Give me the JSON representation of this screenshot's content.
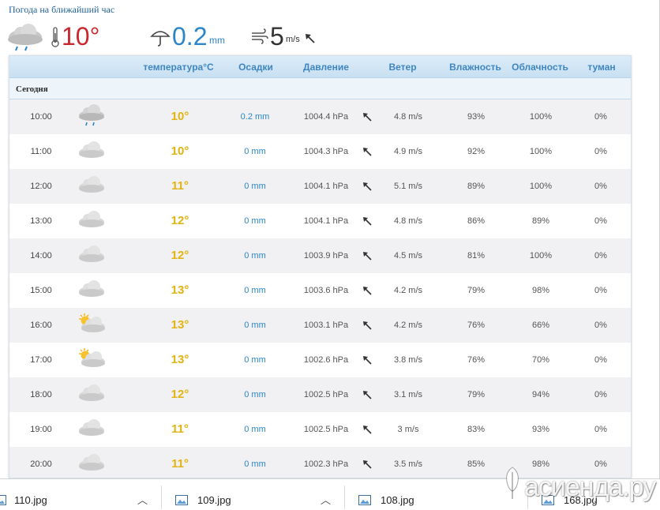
{
  "header": {
    "title": "Погода на ближайший час"
  },
  "now": {
    "temperature": "10°",
    "precipitation": "0.2",
    "precipitation_unit": "mm",
    "wind_speed": "5",
    "wind_unit": "m/s",
    "icons": [
      "rain-cloud-icon",
      "thermometer-icon",
      "umbrella-icon",
      "wind-icon",
      "wind-direction-arrow-icon"
    ]
  },
  "table": {
    "columns": [
      "температура°C",
      "Осадки",
      "Давление",
      "Ветер",
      "Влажность",
      "Облачность",
      "туман"
    ],
    "day_label": "Сегодня",
    "rows": [
      {
        "time": "10:00",
        "icon": "rain-cloud-icon",
        "temp": "10°",
        "precip": "0.2 mm",
        "pressure": "1004.4 hPa",
        "wind": "4.8 m/s",
        "humidity": "93%",
        "cloudiness": "100%",
        "fog": "0%"
      },
      {
        "time": "11:00",
        "icon": "cloud-icon",
        "temp": "10°",
        "precip": "0 mm",
        "pressure": "1004.3 hPa",
        "wind": "4.9 m/s",
        "humidity": "92%",
        "cloudiness": "100%",
        "fog": "0%"
      },
      {
        "time": "12:00",
        "icon": "cloud-icon",
        "temp": "11°",
        "precip": "0 mm",
        "pressure": "1004.1 hPa",
        "wind": "5.1 m/s",
        "humidity": "89%",
        "cloudiness": "100%",
        "fog": "0%"
      },
      {
        "time": "13:00",
        "icon": "cloud-icon",
        "temp": "12°",
        "precip": "0 mm",
        "pressure": "1004.1 hPa",
        "wind": "4.8 m/s",
        "humidity": "86%",
        "cloudiness": "89%",
        "fog": "0%"
      },
      {
        "time": "14:00",
        "icon": "cloud-icon",
        "temp": "12°",
        "precip": "0 mm",
        "pressure": "1003.9 hPa",
        "wind": "4.5 m/s",
        "humidity": "81%",
        "cloudiness": "100%",
        "fog": "0%"
      },
      {
        "time": "15:00",
        "icon": "cloud-icon",
        "temp": "13°",
        "precip": "0 mm",
        "pressure": "1003.6 hPa",
        "wind": "4.2 m/s",
        "humidity": "79%",
        "cloudiness": "98%",
        "fog": "0%"
      },
      {
        "time": "16:00",
        "icon": "sun-cloud-icon",
        "temp": "13°",
        "precip": "0 mm",
        "pressure": "1003.1 hPa",
        "wind": "4.2 m/s",
        "humidity": "76%",
        "cloudiness": "66%",
        "fog": "0%"
      },
      {
        "time": "17:00",
        "icon": "sun-cloud-icon",
        "temp": "13°",
        "precip": "0 mm",
        "pressure": "1002.6 hPa",
        "wind": "3.8 m/s",
        "humidity": "76%",
        "cloudiness": "70%",
        "fog": "0%"
      },
      {
        "time": "18:00",
        "icon": "cloud-icon",
        "temp": "12°",
        "precip": "0 mm",
        "pressure": "1002.5 hPa",
        "wind": "3.1 m/s",
        "humidity": "79%",
        "cloudiness": "94%",
        "fog": "0%"
      },
      {
        "time": "19:00",
        "icon": "cloud-icon",
        "temp": "11°",
        "precip": "0 mm",
        "pressure": "1002.5 hPa",
        "wind": "3 m/s",
        "humidity": "83%",
        "cloudiness": "93%",
        "fog": "0%"
      },
      {
        "time": "20:00",
        "icon": "cloud-icon",
        "temp": "11°",
        "precip": "0 mm",
        "pressure": "1002.3 hPa",
        "wind": "3.5 m/s",
        "humidity": "85%",
        "cloudiness": "98%",
        "fog": "0%"
      }
    ]
  },
  "downloads": [
    {
      "name": "110.jpg",
      "icon": "image-file-icon"
    },
    {
      "name": "109.jpg",
      "icon": "image-file-icon"
    },
    {
      "name": "108.jpg",
      "icon": "image-file-icon"
    },
    {
      "name": "168.jpg",
      "icon": "image-file-icon"
    }
  ],
  "watermark": {
    "text": "асиенда.ру"
  },
  "colors": {
    "temp": "#e0b41e",
    "now_temp": "#c8272e",
    "precip": "#2a86c8",
    "header_text": "#3f86c0",
    "header_bg": "#cfe4f4"
  }
}
